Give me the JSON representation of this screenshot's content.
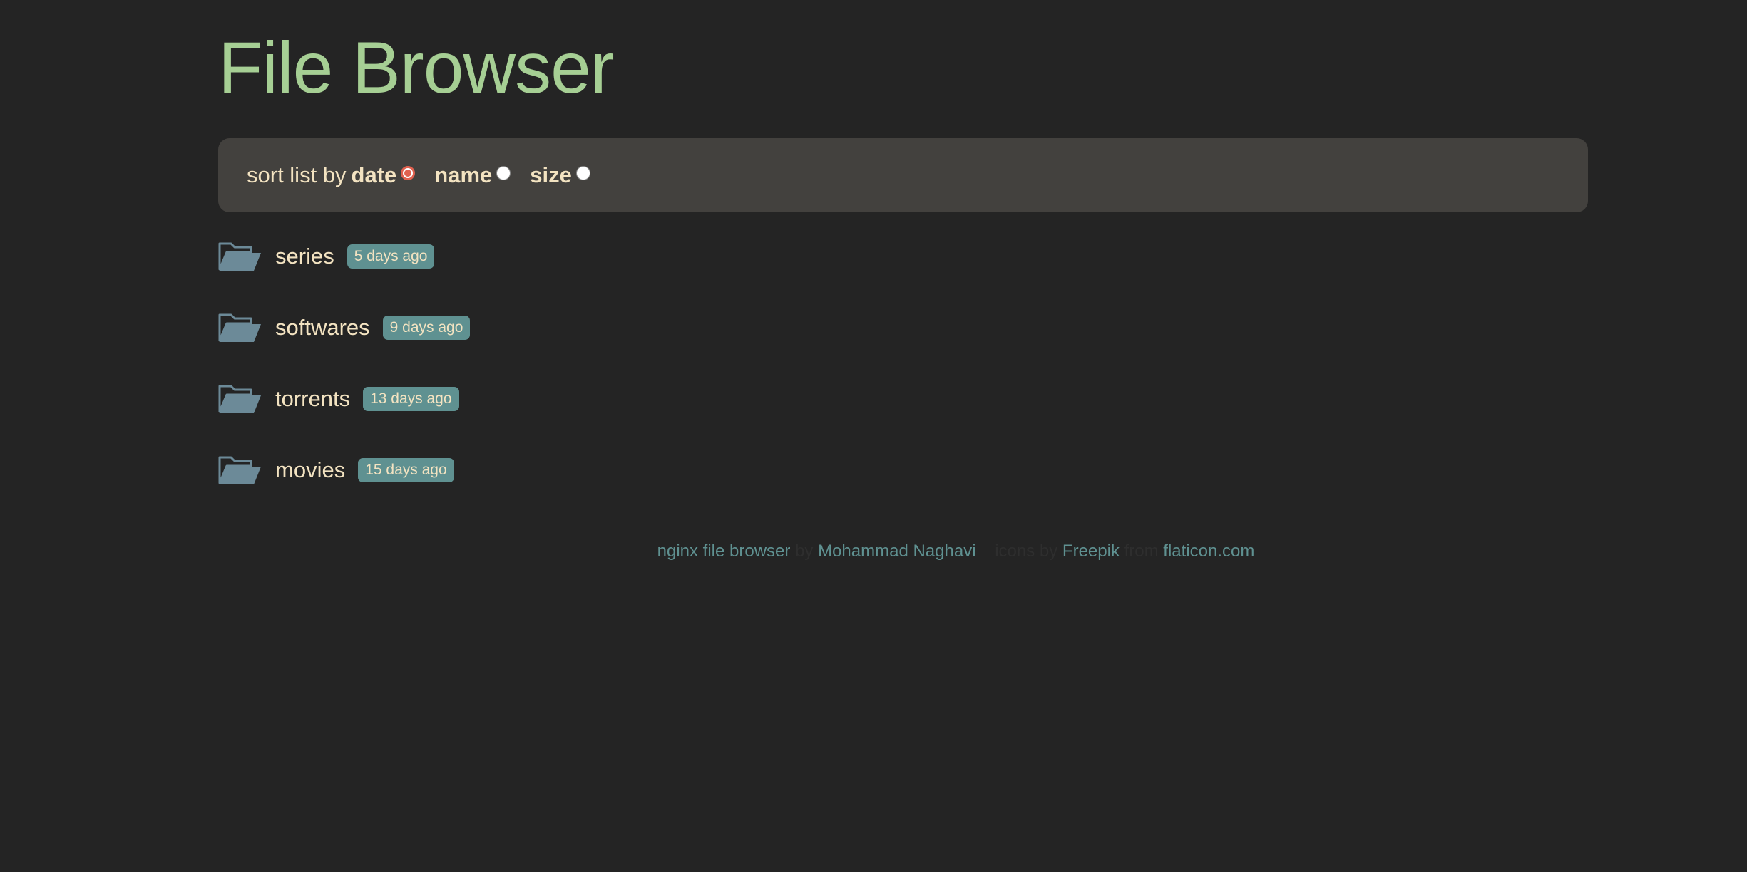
{
  "header": {
    "title": "File Browser"
  },
  "sort": {
    "label": "sort list by",
    "options": [
      {
        "label": "date",
        "checked": true
      },
      {
        "label": "name",
        "checked": false
      },
      {
        "label": "size",
        "checked": false
      }
    ]
  },
  "entries": [
    {
      "name": "series",
      "age": "5 days ago",
      "icon": "folder-icon"
    },
    {
      "name": "softwares",
      "age": "9 days ago",
      "icon": "folder-icon"
    },
    {
      "name": "torrents",
      "age": "13 days ago",
      "icon": "folder-icon"
    },
    {
      "name": "movies",
      "age": "15 days ago",
      "icon": "folder-icon"
    }
  ],
  "footer": {
    "project_link": "nginx file browser",
    "author_link": "Mohammad Naghavi",
    "text_by": "by",
    "icons_text": "icons by",
    "freepik_link": "Freepik",
    "from_text": "from",
    "flaticon_link": "flaticon.com"
  },
  "colors": {
    "background": "#242424",
    "title": "#a6cf94",
    "text": "#f3e3c1",
    "badge": "#5f9191",
    "link": "#5f9191",
    "accent": "#e0614f"
  }
}
